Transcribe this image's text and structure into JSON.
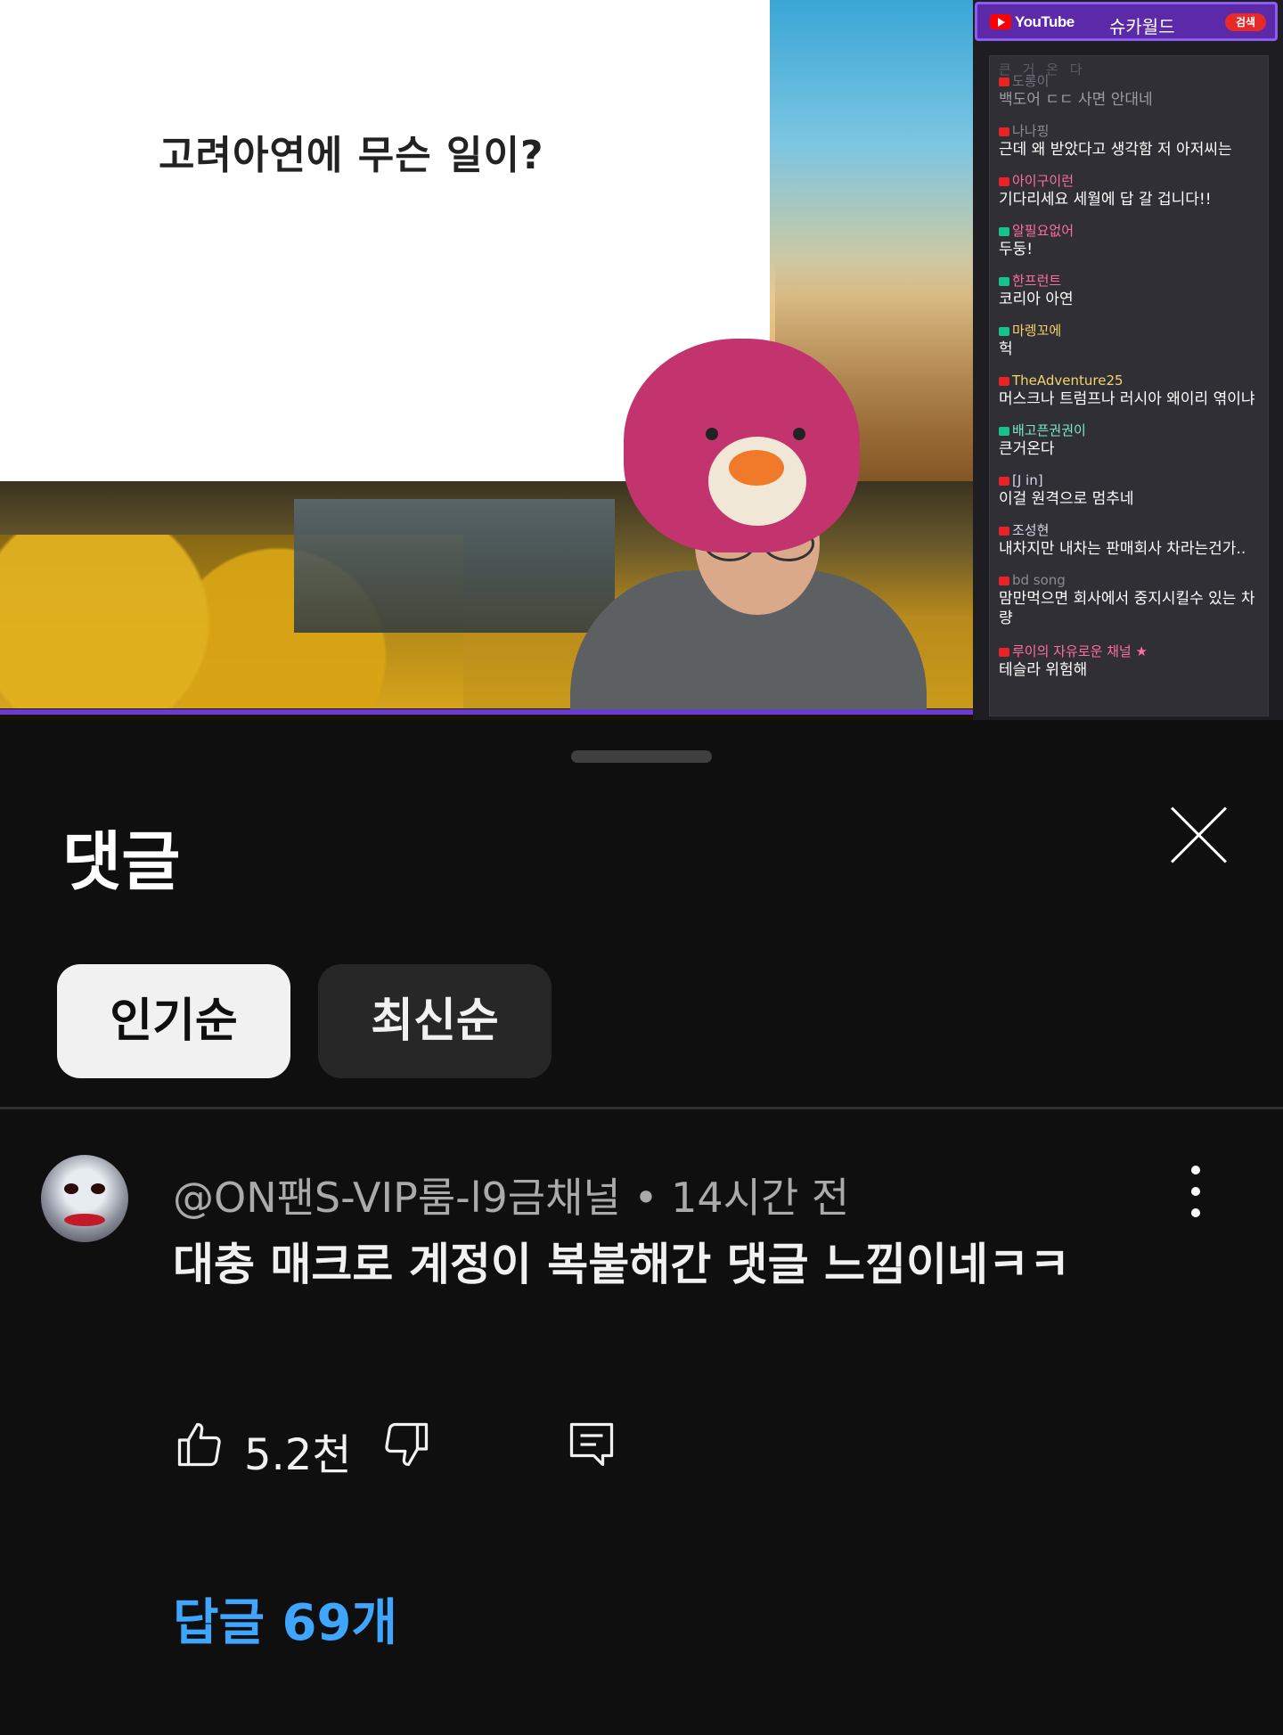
{
  "video": {
    "slide_title": "고려아연에 무슨 일이?",
    "chat": {
      "platform": "YouTube",
      "channel": "슈카월드",
      "search_label": "검색",
      "top_partial": "큰 거 온 다",
      "messages": [
        {
          "user": "도롱이",
          "text": "백도어 ㄷㄷ 사면 안대네",
          "icon": "youtube-icon",
          "dim": true,
          "user_color": "dim"
        },
        {
          "user": "나나핑",
          "text": "근데 왜 받았다고 생각함 저 아저씨는",
          "icon": "youtube-icon",
          "dim": false,
          "user_color": "dim"
        },
        {
          "user": "아이구이런",
          "text": "기다리세요 세월에 답 갈 겁니다!!",
          "icon": "youtube-icon",
          "dim": false,
          "user_color": "pink"
        },
        {
          "user": "알필요없어",
          "text": "두둥!",
          "icon": "chzzk-icon",
          "dim": false,
          "user_color": "pink"
        },
        {
          "user": "한프런트",
          "text": "코리아 아연",
          "icon": "chzzk-icon",
          "dim": false,
          "user_color": "pink"
        },
        {
          "user": "마렝꼬에",
          "text": "헉",
          "icon": "chzzk-icon",
          "dim": false,
          "user_color": "yellow"
        },
        {
          "user": "TheAdventure25",
          "text": "머스크나 트럼프나 러시아 왜이리 엮이냐",
          "icon": "youtube-icon",
          "dim": false,
          "user_color": "yellow"
        },
        {
          "user": "배고픈권권이",
          "text": "큰거온다",
          "icon": "chzzk-icon",
          "dim": false,
          "user_color": "mint"
        },
        {
          "user": "[J in]",
          "text": "이걸 원격으로 멈추네",
          "icon": "youtube-icon",
          "dim": false,
          "user_color": "light"
        },
        {
          "user": "조성현",
          "text": "내차지만 내차는 판매회사 차라는건가..",
          "icon": "youtube-icon",
          "dim": false,
          "user_color": "light"
        },
        {
          "user": "bd song",
          "text": "맘만먹으면 회사에서 중지시킬수 있는 차",
          "text2": "량",
          "icon": "youtube-icon",
          "dim": false,
          "user_color": "dim"
        },
        {
          "user": "루이의 자유로운 채널 ★",
          "text": "테슬라 위험해",
          "icon": "youtube-icon",
          "dim": false,
          "user_color": "pink"
        }
      ]
    }
  },
  "comments": {
    "title": "댓글",
    "sort_tabs": [
      "인기순",
      "최신순"
    ],
    "active_tab": "인기순",
    "comment": {
      "author": "@ON팬S-VIP룸-l9금채널",
      "time": "14시간 전",
      "meta": "@ON팬S-VIP룸-l9금채널 • 14시간 전",
      "body": "대충 매크로 계정이 복붙해간 댓글 느낌이네ㅋㅋ",
      "likes": "5.2천",
      "replies_label": "답글 69개"
    }
  },
  "colors": {
    "background": "#0f0f0f",
    "chip_active_bg": "#f1f1f1",
    "chip_inactive_bg": "#272727",
    "reply_link": "#3ea6ff",
    "chat_header": "#5c2aa8"
  }
}
